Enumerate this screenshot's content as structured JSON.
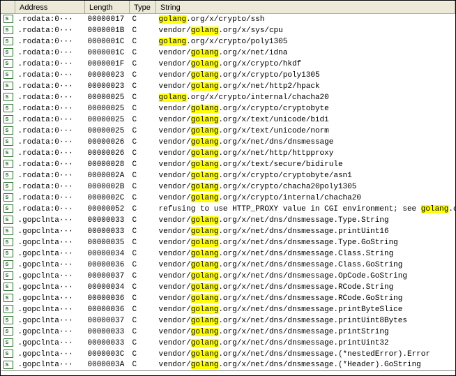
{
  "columns": {
    "address": "Address",
    "length": "Length",
    "type": "Type",
    "string": "String"
  },
  "highlight_term": "golang",
  "rows": [
    {
      "addr": ".rodata:0···",
      "len": "00000017",
      "type": "C",
      "str": "golang.org/x/crypto/ssh"
    },
    {
      "addr": ".rodata:0···",
      "len": "0000001B",
      "type": "C",
      "str": "vendor/golang.org/x/sys/cpu"
    },
    {
      "addr": ".rodata:0···",
      "len": "0000001C",
      "type": "C",
      "str": "golang.org/x/crypto/poly1305"
    },
    {
      "addr": ".rodata:0···",
      "len": "0000001C",
      "type": "C",
      "str": "vendor/golang.org/x/net/idna"
    },
    {
      "addr": ".rodata:0···",
      "len": "0000001F",
      "type": "C",
      "str": "vendor/golang.org/x/crypto/hkdf"
    },
    {
      "addr": ".rodata:0···",
      "len": "00000023",
      "type": "C",
      "str": "vendor/golang.org/x/crypto/poly1305"
    },
    {
      "addr": ".rodata:0···",
      "len": "00000023",
      "type": "C",
      "str": "vendor/golang.org/x/net/http2/hpack"
    },
    {
      "addr": ".rodata:0···",
      "len": "00000025",
      "type": "C",
      "str": "golang.org/x/crypto/internal/chacha20"
    },
    {
      "addr": ".rodata:0···",
      "len": "00000025",
      "type": "C",
      "str": "vendor/golang.org/x/crypto/cryptobyte"
    },
    {
      "addr": ".rodata:0···",
      "len": "00000025",
      "type": "C",
      "str": "vendor/golang.org/x/text/unicode/bidi"
    },
    {
      "addr": ".rodata:0···",
      "len": "00000025",
      "type": "C",
      "str": "vendor/golang.org/x/text/unicode/norm"
    },
    {
      "addr": ".rodata:0···",
      "len": "00000026",
      "type": "C",
      "str": "vendor/golang.org/x/net/dns/dnsmessage"
    },
    {
      "addr": ".rodata:0···",
      "len": "00000026",
      "type": "C",
      "str": "vendor/golang.org/x/net/http/httpproxy"
    },
    {
      "addr": ".rodata:0···",
      "len": "00000028",
      "type": "C",
      "str": "vendor/golang.org/x/text/secure/bidirule"
    },
    {
      "addr": ".rodata:0···",
      "len": "0000002A",
      "type": "C",
      "str": "vendor/golang.org/x/crypto/cryptobyte/asn1"
    },
    {
      "addr": ".rodata:0···",
      "len": "0000002B",
      "type": "C",
      "str": "vendor/golang.org/x/crypto/chacha20poly1305"
    },
    {
      "addr": ".rodata:0···",
      "len": "0000002C",
      "type": "C",
      "str": "vendor/golang.org/x/crypto/internal/chacha20"
    },
    {
      "addr": ".rodata:0···",
      "len": "00000052",
      "type": "C",
      "str": "refusing to use HTTP_PROXY value in CGI environment; see golang.or···"
    },
    {
      "addr": ".gopclnta···",
      "len": "00000033",
      "type": "C",
      "str": "vendor/golang.org/x/net/dns/dnsmessage.Type.String"
    },
    {
      "addr": ".gopclnta···",
      "len": "00000033",
      "type": "C",
      "str": "vendor/golang.org/x/net/dns/dnsmessage.printUint16"
    },
    {
      "addr": ".gopclnta···",
      "len": "00000035",
      "type": "C",
      "str": "vendor/golang.org/x/net/dns/dnsmessage.Type.GoString"
    },
    {
      "addr": ".gopclnta···",
      "len": "00000034",
      "type": "C",
      "str": "vendor/golang.org/x/net/dns/dnsmessage.Class.String"
    },
    {
      "addr": ".gopclnta···",
      "len": "00000036",
      "type": "C",
      "str": "vendor/golang.org/x/net/dns/dnsmessage.Class.GoString"
    },
    {
      "addr": ".gopclnta···",
      "len": "00000037",
      "type": "C",
      "str": "vendor/golang.org/x/net/dns/dnsmessage.OpCode.GoString"
    },
    {
      "addr": ".gopclnta···",
      "len": "00000034",
      "type": "C",
      "str": "vendor/golang.org/x/net/dns/dnsmessage.RCode.String"
    },
    {
      "addr": ".gopclnta···",
      "len": "00000036",
      "type": "C",
      "str": "vendor/golang.org/x/net/dns/dnsmessage.RCode.GoString"
    },
    {
      "addr": ".gopclnta···",
      "len": "00000036",
      "type": "C",
      "str": "vendor/golang.org/x/net/dns/dnsmessage.printByteSlice"
    },
    {
      "addr": ".gopclnta···",
      "len": "00000037",
      "type": "C",
      "str": "vendor/golang.org/x/net/dns/dnsmessage.printUint8Bytes"
    },
    {
      "addr": ".gopclnta···",
      "len": "00000033",
      "type": "C",
      "str": "vendor/golang.org/x/net/dns/dnsmessage.printString"
    },
    {
      "addr": ".gopclnta···",
      "len": "00000033",
      "type": "C",
      "str": "vendor/golang.org/x/net/dns/dnsmessage.printUint32"
    },
    {
      "addr": ".gopclnta···",
      "len": "0000003C",
      "type": "C",
      "str": "vendor/golang.org/x/net/dns/dnsmessage.(*nestedError).Error"
    },
    {
      "addr": ".gopclnta···",
      "len": "0000003A",
      "type": "C",
      "str": "vendor/golang.org/x/net/dns/dnsmessage.(*Header).GoString"
    }
  ]
}
